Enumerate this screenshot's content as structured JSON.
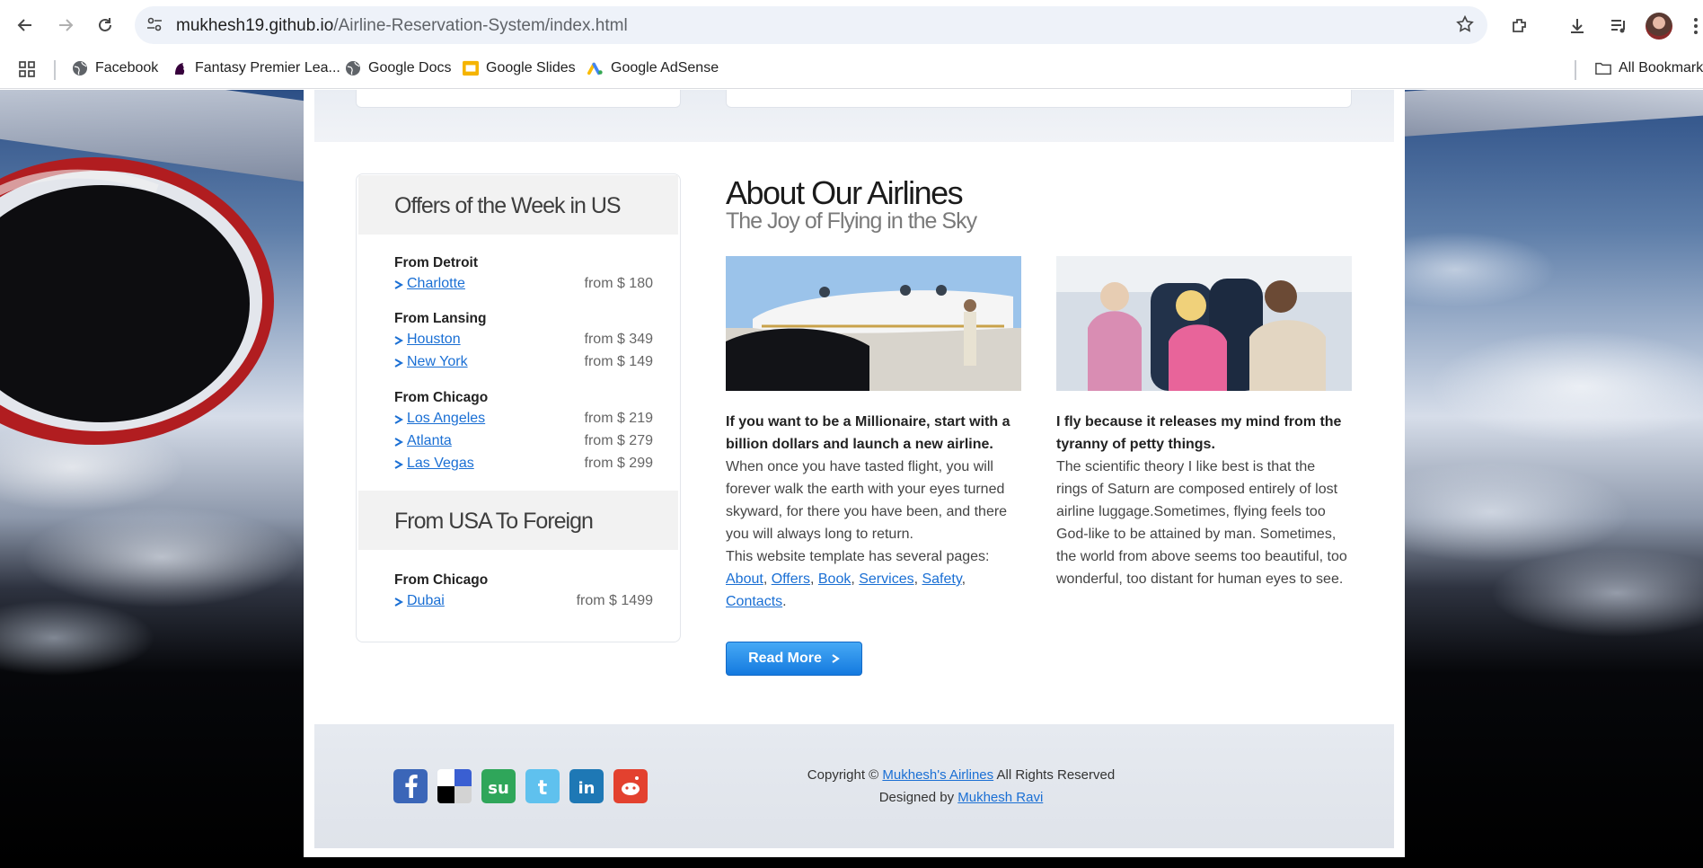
{
  "browser": {
    "url_host": "mukhesh19.github.io",
    "url_path": "/Airline-Reservation-System/index.html",
    "bookmarks": [
      "Facebook",
      "Fantasy Premier Lea...",
      "Google Docs",
      "Google Slides",
      "Google AdSense"
    ],
    "all_bookmarks": "All Bookmarks"
  },
  "offers": {
    "title_us": "Offers of the Week in US",
    "title_foreign": "From USA To Foreign",
    "groups": [
      {
        "from": "From Detroit",
        "destinations": [
          {
            "city": "Charlotte",
            "price": "from $ 180"
          }
        ]
      },
      {
        "from": "From Lansing",
        "destinations": [
          {
            "city": "Houston",
            "price": "from $ 349"
          },
          {
            "city": "New York",
            "price": "from $ 149"
          }
        ]
      },
      {
        "from": "From Chicago",
        "destinations": [
          {
            "city": "Los Angeles",
            "price": "from $ 219"
          },
          {
            "city": "Atlanta",
            "price": "from $ 279"
          },
          {
            "city": "Las Vegas",
            "price": "from $ 299"
          }
        ]
      }
    ],
    "foreign_groups": [
      {
        "from": "From Chicago",
        "destinations": [
          {
            "city": "Dubai",
            "price": "from $ 1499"
          }
        ]
      }
    ]
  },
  "about": {
    "title": "About Our Airlines",
    "subtitle": "The Joy of Flying in the Sky",
    "col1_bold": "If you want to be a Millionaire, start with a billion dollars and launch a new airline.",
    "col1_text": "When once you have tasted flight, you will forever walk the earth with your eyes turned skyward, for there you have been, and there you will always long to return.",
    "col1_pages_intro": "This website template has several pages:",
    "page_links": [
      "About",
      "Offers",
      "Book",
      "Services",
      "Safety",
      "Contacts"
    ],
    "col2_bold": "I fly because it releases my mind from the tyranny of petty things.",
    "col2_text": "The scientific theory I like best is that the rings of Saturn are composed entirely of lost airline luggage.Sometimes, flying feels too God-like to be attained by man. Sometimes, the world from above seems too beautiful, too wonderful, too distant for human eyes to see.",
    "read_more": "Read More"
  },
  "footer": {
    "copyright_prefix": "Copyright ©",
    "company_link": "Mukhesh's Airlines",
    "rights": "All Rights Reserved",
    "designed_by": "Designed by",
    "designer_link": "Mukhesh Ravi",
    "social": [
      "facebook",
      "delicious",
      "stumbleupon",
      "twitter",
      "linkedin",
      "reddit"
    ]
  },
  "colors": {
    "link": "#1a6fd4",
    "button": "#1479df"
  }
}
